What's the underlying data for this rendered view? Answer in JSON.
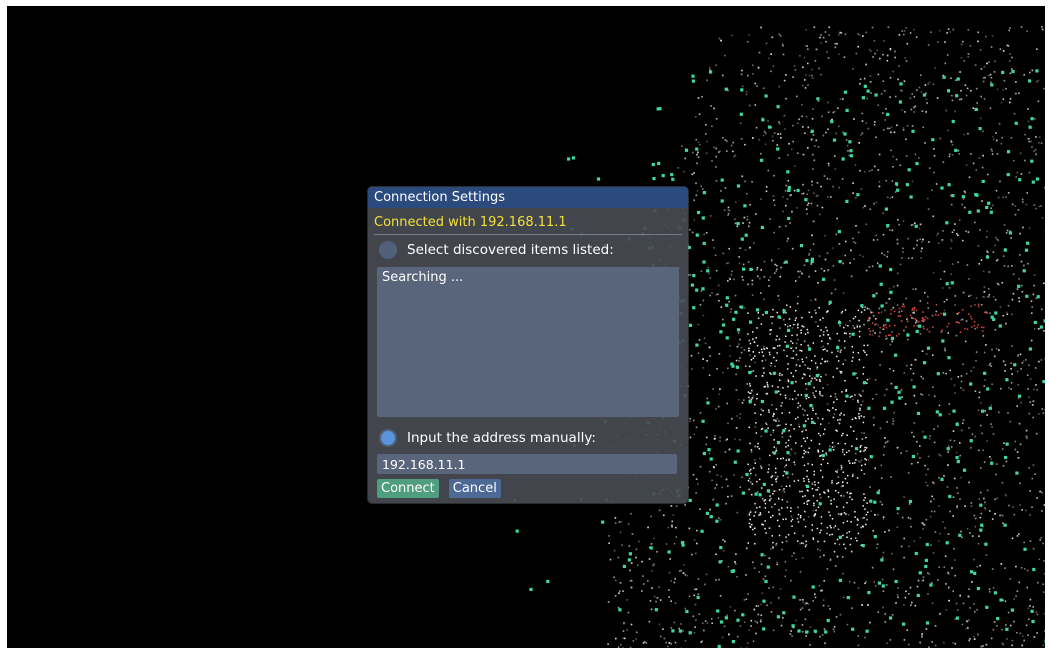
{
  "dialog": {
    "title": "Connection Settings",
    "status": "Connected with 192.168.11.1",
    "discover_option": {
      "label": "Select discovered items listed:",
      "selected": false
    },
    "discovered_list": {
      "text": "Searching ..."
    },
    "manual_option": {
      "label": "Input the address manually:",
      "selected": true
    },
    "address_value": "192.168.11.1",
    "buttons": {
      "connect": "Connect",
      "cancel": "Cancel"
    }
  },
  "colors": {
    "title_bar": "#2b4a7e",
    "status_text": "#f2e03a",
    "connect_button": "#4f9e80",
    "cancel_button": "#4d6a96",
    "radio_selected": "#5b94de",
    "point_teal": "#3fd6a3",
    "point_red": "#d0402e"
  }
}
